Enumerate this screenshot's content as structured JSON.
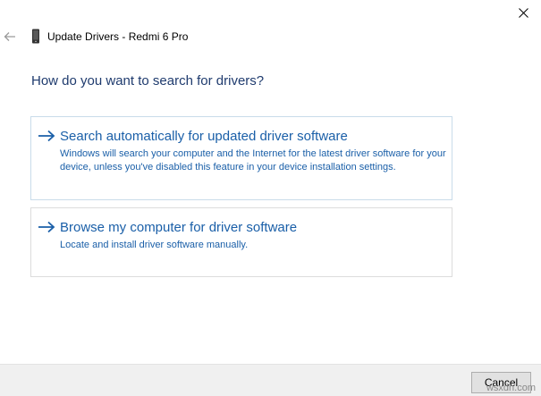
{
  "window": {
    "title": "Update Drivers - Redmi 6 Pro",
    "close_glyph": "✕",
    "back_glyph": "←"
  },
  "main": {
    "heading": "How do you want to search for drivers?",
    "options": [
      {
        "title": "Search automatically for updated driver software",
        "description": "Windows will search your computer and the Internet for the latest driver software for your device, unless you've disabled this feature in your device installation settings."
      },
      {
        "title": "Browse my computer for driver software",
        "description": "Locate and install driver software manually."
      }
    ]
  },
  "footer": {
    "cancel_label": "Cancel"
  },
  "watermark": "wsxdn.com",
  "colors": {
    "accent": "#1a5fa8",
    "heading": "#1f3b6e",
    "option_border": "#c9dcea"
  }
}
